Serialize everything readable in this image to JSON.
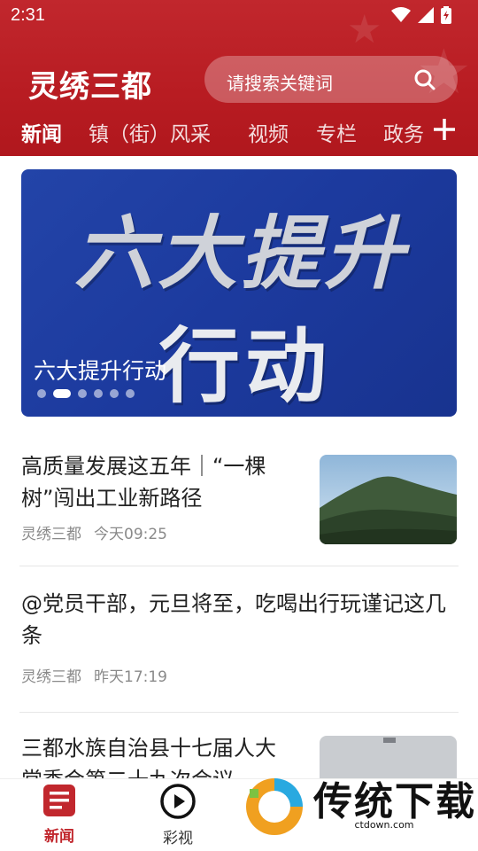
{
  "status_bar": {
    "time": "2:31"
  },
  "header": {
    "app_title": "灵绣三都",
    "search_placeholder": "请搜索关键词",
    "tabs": [
      "新闻",
      "镇（街）风采",
      "视频",
      "专栏",
      "政务"
    ],
    "add_icon": "plus-icon"
  },
  "banner": {
    "image_text_line1": "六大提升",
    "image_text_line2": "行动",
    "caption": "六大提升行动",
    "slide_count": 6,
    "active_slide": 2
  },
  "news": [
    {
      "title": "高质量发展这五年｜“一棵树”闯出工业新路径",
      "source": "灵绣三都",
      "time": "今天09:25",
      "has_thumb": true
    },
    {
      "title": "@党员干部，元旦将至，吃喝出行玩谨记这几条",
      "source": "灵绣三都",
      "time": "昨天17:19",
      "has_thumb": false
    },
    {
      "title": "三都水族自治县十七届人大常委会第二十九次会议",
      "source": "",
      "time": "",
      "has_thumb": true
    }
  ],
  "bottom_nav": [
    {
      "label": "新闻",
      "icon": "news-icon",
      "active": true
    },
    {
      "label": "彩视",
      "icon": "play-icon",
      "active": false
    }
  ],
  "watermark": {
    "text": "传统下载",
    "sub": "ctdown.com"
  },
  "colors": {
    "primary": "#b81c22",
    "banner_bg": "#1c3a9e",
    "text": "#222222",
    "meta": "#8a8a8a"
  }
}
